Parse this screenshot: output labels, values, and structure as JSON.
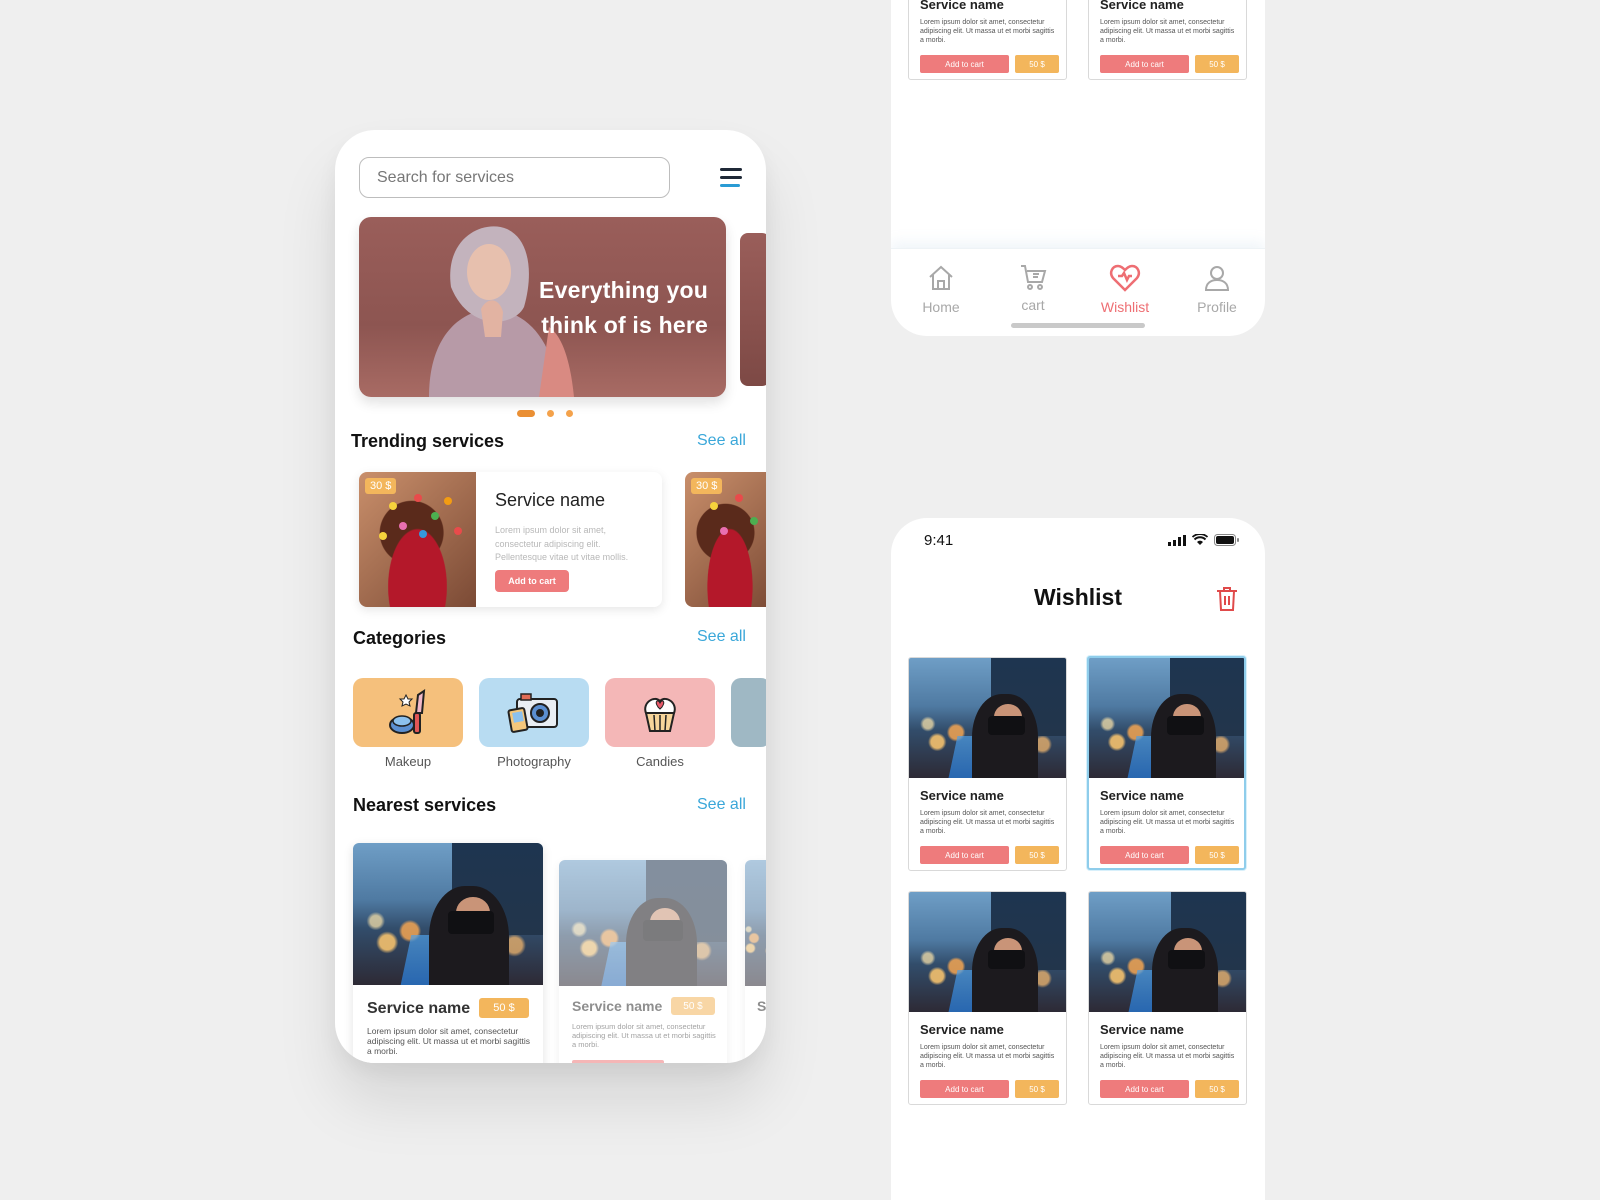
{
  "home": {
    "search_placeholder": "Search for services",
    "banner_line1": "Everything you",
    "banner_line2": "think of is here",
    "trending": {
      "title": "Trending services",
      "see_all": "See all",
      "card": {
        "price": "30 $",
        "name": "Service name",
        "desc": "Lorem ipsum dolor sit amet, consectetur adipiscing elit. Pellentesque vitae ut vitae mollis.",
        "button": "Add to cart"
      },
      "peek_price": "30 $"
    },
    "categories": {
      "title": "Categories",
      "see_all": "See all",
      "items": [
        {
          "label": "Makeup",
          "color": "#f5c07c",
          "icon": "makeup-icon"
        },
        {
          "label": "Photography",
          "color": "#b8dcf2",
          "icon": "camera-icon"
        },
        {
          "label": "Candies",
          "color": "#f4b7b7",
          "icon": "cupcake-icon"
        }
      ],
      "peek_color": "#9fb8c4"
    },
    "nearest": {
      "title": "Nearest services",
      "see_all": "See all",
      "cards": [
        {
          "name": "Service name",
          "price": "50 $",
          "desc": "Lorem ipsum dolor sit amet, consectetur adipiscing elit. Ut massa ut et morbi sagittis a morbi."
        },
        {
          "name": "Service name",
          "price": "50 $",
          "desc": "Lorem ipsum dolor sit amet, consectetur adipiscing elit. Ut massa ut et morbi sagittis a morbi."
        },
        {
          "name": "S"
        }
      ]
    }
  },
  "top_cards": [
    {
      "name": "Service name",
      "desc": "Lorem ipsum dolor sit amet, consectetur adipiscing elit. Ut massa ut et morbi sagittis a morbi.",
      "add": "Add to cart",
      "price": "50 $"
    },
    {
      "name": "Service name",
      "desc": "Lorem ipsum dolor sit amet, consectetur adipiscing elit. Ut massa ut et morbi sagittis a morbi.",
      "add": "Add to cart",
      "price": "50 $"
    }
  ],
  "bottom_nav": {
    "items": [
      {
        "label": "Home",
        "icon": "home-icon"
      },
      {
        "label": "cart",
        "icon": "cart-icon"
      },
      {
        "label": "Wishlist",
        "icon": "heart-icon",
        "active": true
      },
      {
        "label": "Profile",
        "icon": "user-icon"
      }
    ]
  },
  "wishlist": {
    "status_time": "9:41",
    "title": "Wishlist",
    "cards": [
      {
        "name": "Service name",
        "desc": "Lorem ipsum dolor sit amet, consectetur adipiscing elit. Ut massa ut et morbi sagittis a morbi.",
        "add": "Add to cart",
        "price": "50 $"
      },
      {
        "name": "Service name",
        "desc": "Lorem ipsum dolor sit amet, consectetur adipiscing elit. Ut massa ut et morbi sagittis a morbi.",
        "add": "Add to cart",
        "price": "50 $",
        "selected": true
      },
      {
        "name": "Service name",
        "desc": "Lorem ipsum dolor sit amet, consectetur adipiscing elit. Ut massa ut et morbi sagittis a morbi.",
        "add": "Add to cart",
        "price": "50 $"
      },
      {
        "name": "Service name",
        "desc": "Lorem ipsum dolor sit amet, consectetur adipiscing elit. Ut massa ut et morbi sagittis a morbi.",
        "add": "Add to cart",
        "price": "50 $"
      }
    ]
  },
  "colors": {
    "accent_red": "#ee7b7c",
    "accent_yellow": "#f3b65c",
    "link_blue": "#3aa7d9",
    "active_dot": "#ea8f34"
  }
}
